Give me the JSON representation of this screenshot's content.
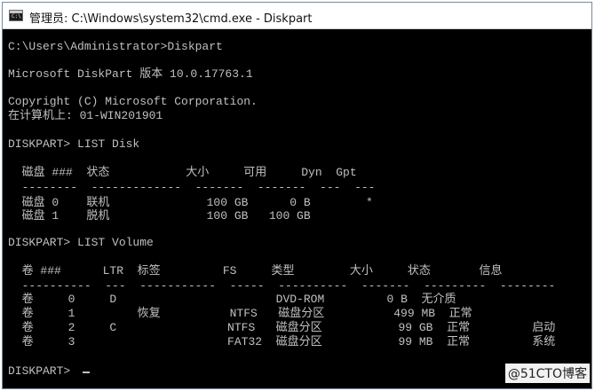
{
  "window": {
    "title": "管理员: C:\\Windows\\system32\\cmd.exe - Diskpart",
    "icon": "command-prompt-icon",
    "console_background": "#000000",
    "console_text_color": "#c0c0c0"
  },
  "console_lines": [
    "C:\\Users\\Administrator>Diskpart",
    "",
    "Microsoft DiskPart 版本 10.0.17763.1",
    "",
    "Copyright (C) Microsoft Corporation.",
    "在计算机上: 01-WIN201901",
    "",
    "DISKPART> LIST Disk",
    "",
    "  磁盘 ###  状态           大小     可用     Dyn  Gpt",
    "  --------  -------------  -------  -------  ---  ---",
    "  磁盘 0    联机              100 GB      0 B        *",
    "  磁盘 1    脱机              100 GB   100 GB",
    "",
    "DISKPART> LIST Volume",
    "",
    "  卷 ###      LTR  标签         FS     类型        大小     状态       信息",
    "  ----------  ---  -----------  -----  ----------  -------  ---------  --------",
    "  卷     0     D                       DVD-ROM         0 B  无介质",
    "  卷     1         恢复          NTFS   磁盘分区          499 MB  正常",
    "  卷     2     C                NTFS   磁盘分区           99 GB  正常         启动",
    "  卷     3                      FAT32  磁盘分区           99 MB  正常         系统",
    "",
    "DISKPART> "
  ],
  "watermark": "@51CTO博客"
}
